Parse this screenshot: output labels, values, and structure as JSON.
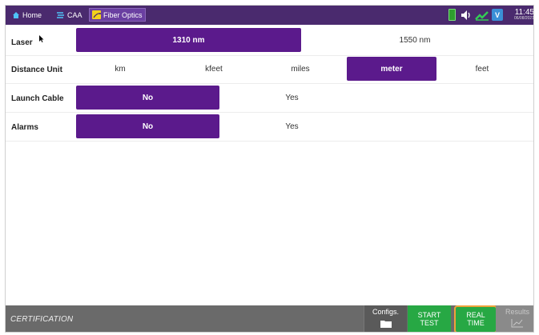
{
  "topbar": {
    "tabs": [
      {
        "label": "Home",
        "icon": "home-icon"
      },
      {
        "label": "CAA",
        "icon": "caa-icon"
      },
      {
        "label": "Fiber Optics",
        "icon": "fiber-optics-icon"
      }
    ],
    "volume_badge": "V",
    "time": "11:45",
    "date": "06/08/2021"
  },
  "settings": {
    "laser": {
      "label": "Laser",
      "options": [
        "1310 nm",
        "1550 nm"
      ],
      "selected": "1310 nm"
    },
    "distance_unit": {
      "label": "Distance Unit",
      "options": [
        "km",
        "kfeet",
        "miles",
        "meter",
        "feet"
      ],
      "selected": "meter"
    },
    "launch_cable": {
      "label": "Launch Cable",
      "options": [
        "No",
        "Yes"
      ],
      "selected": "No"
    },
    "alarms": {
      "label": "Alarms",
      "options": [
        "No",
        "Yes"
      ],
      "selected": "No"
    }
  },
  "bottombar": {
    "mode": "CERTIFICATION",
    "configs": "Configs.",
    "start_line1": "START",
    "start_line2": "TEST",
    "realtime_line1": "REAL",
    "realtime_line2": "TIME",
    "results": "Results"
  },
  "colors": {
    "topbar": "#4a2a6e",
    "selected": "#5b1a8c",
    "green_button": "#27a844",
    "highlight": "#f0a33a",
    "bottombar": "#6a6a6a"
  }
}
